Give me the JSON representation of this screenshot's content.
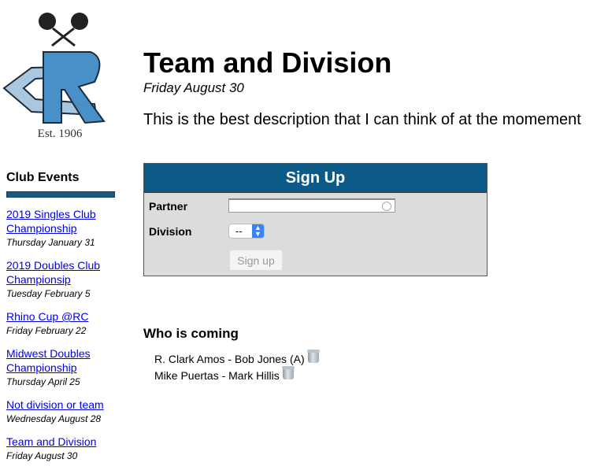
{
  "logo": {
    "caption": "Est. 1906",
    "monogram": "RC"
  },
  "header": {
    "title": "Team and Division",
    "date": "Friday August 30",
    "description": "This is the best description that I can think of at the momement"
  },
  "sidebar": {
    "title": "Club Events",
    "accent_color": "#1a5a80",
    "events": [
      {
        "label": "2019 Singles Club Championship",
        "date": "Thursday January 31"
      },
      {
        "label": "2019 Doubles Club Championsip",
        "date": "Tuesday February 5"
      },
      {
        "label": "Rhino Cup @RC",
        "date": "Friday February 22"
      },
      {
        "label": "Midwest Doubles Championship",
        "date": "Thursday April 25"
      },
      {
        "label": "Not division or team",
        "date": "Wednesday August 28"
      },
      {
        "label": "Team and Division",
        "date": "Friday August 30"
      }
    ]
  },
  "signup": {
    "title": "Sign Up",
    "header_color": "#0c5a88",
    "partner_label": "Partner",
    "partner_value": "",
    "division_label": "Division",
    "division_selected": "--",
    "button_label": "Sign up"
  },
  "attendance": {
    "title": "Who is coming",
    "entries": [
      {
        "text": "R. Clark Amos - Bob Jones (A)",
        "icon": "trash-icon"
      },
      {
        "text": "Mike Puertas - Mark Hillis",
        "icon": "trash-icon"
      }
    ]
  }
}
